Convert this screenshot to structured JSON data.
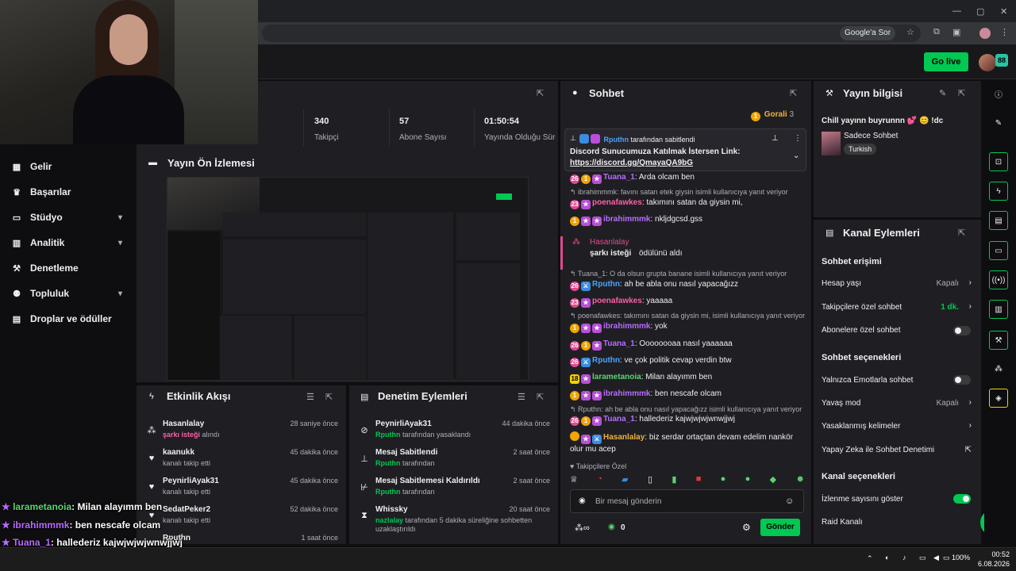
{
  "browser": {
    "google_sor": "Google'a Sor"
  },
  "header": {
    "go_live": "Go live",
    "avatar_badge": "88"
  },
  "nav": [
    {
      "label": "Gelir",
      "icon": "revenue-icon",
      "chevron": false
    },
    {
      "label": "Başarılar",
      "icon": "trophy-icon",
      "chevron": false
    },
    {
      "label": "Stüdyo",
      "icon": "studio-icon",
      "chevron": true
    },
    {
      "label": "Analitik",
      "icon": "analytics-icon",
      "chevron": true
    },
    {
      "label": "Denetleme",
      "icon": "wrench-icon",
      "chevron": false
    },
    {
      "label": "Topluluk",
      "icon": "community-icon",
      "chevron": true
    },
    {
      "label": "Droplar ve ödüller",
      "icon": "gift-icon",
      "chevron": false
    }
  ],
  "stats": [
    {
      "value": "340",
      "label": "Takipçi"
    },
    {
      "value": "57",
      "label": "Abone Sayısı"
    },
    {
      "value": "01:50:54",
      "label": "Yayında Olduğu Süre"
    }
  ],
  "preview": {
    "title": "Yayın Ön İzlemesi"
  },
  "activity": {
    "title": "Etkinlik Akışı",
    "items": [
      {
        "name": "Hasanlalay",
        "sub": "şarkı isteği",
        "sub2": "alındı",
        "time": "28 saniye önce",
        "icon": "channel-points-icon"
      },
      {
        "name": "kaanukk",
        "sub": "kanalı takip etti",
        "sub2": "",
        "time": "45 dakika önce",
        "icon": "heart-icon"
      },
      {
        "name": "PeynirliAyak31",
        "sub": "kanalı takip etti",
        "sub2": "",
        "time": "45 dakika önce",
        "icon": "heart-icon"
      },
      {
        "name": "SedatPeker2",
        "sub": "kanalı takip etti",
        "sub2": "",
        "time": "52 dakika önce",
        "icon": "heart-icon"
      },
      {
        "name": "Rputhn",
        "sub": "",
        "sub2": "",
        "time": "1 saat önce",
        "icon": "heart-icon"
      }
    ]
  },
  "moderation": {
    "title": "Denetim Eylemleri",
    "items": [
      {
        "name": "PeynirliAyak31",
        "actor": "Rputhn",
        "sub": "tarafından yasaklandı",
        "time": "44 dakika önce",
        "icon": "ban-icon"
      },
      {
        "name": "Mesaj Sabitlendi",
        "actor": "Rputhn",
        "sub": "tarafından",
        "time": "2 saat önce",
        "icon": "pin-icon"
      },
      {
        "name": "Mesaj Sabitlemesi Kaldırıldı",
        "actor": "Rputhn",
        "sub": "tarafından",
        "time": "2 saat önce",
        "icon": "unpin-icon"
      },
      {
        "name": "Whissky",
        "actor": "nazlalay",
        "sub": "tarafından 5 dakika süreliğine sohbetten uzaklaştırıldı",
        "time": "20 saat önce",
        "icon": "timeout-icon"
      }
    ]
  },
  "chat": {
    "title": "Sohbet",
    "gorali_label": "Gorali",
    "gorali_count": "3",
    "pinned_by": "Rputhn",
    "pinned_by_suffix": "tarafından sabitlendi",
    "pinned_text": "Discord Sunucumuza Katılmak İstersen Link:",
    "pinned_link": "https://discord.gg/QmayaQA9bG",
    "messages": [
      {
        "type": "msg",
        "badges": [
          "b-sub:26",
          "b-gold:1",
          "b-star"
        ],
        "user": "Tuana_1",
        "ucls": "u-purple",
        "text": ": Arda olcam ben"
      },
      {
        "type": "reply",
        "text": "ibrahimmmk: favını satan etek giysin isimli kullanıcıya yanıt veriyor"
      },
      {
        "type": "msg",
        "badges": [
          "b-sub:23",
          "b-star"
        ],
        "user": "poenafawkes",
        "ucls": "u-pink",
        "text": ": takımını satan da giysin mi,"
      },
      {
        "type": "msg",
        "badges": [
          "b-gold:1",
          "b-star",
          "b-star"
        ],
        "user": "ibrahimmmk",
        "ucls": "u-purple",
        "text": ": nkljdgcsd.gss"
      },
      {
        "type": "redeem",
        "user": "Hasanlalay",
        "text": "şarkı isteği",
        "suffix": "ödülünü aldı"
      },
      {
        "type": "reply",
        "text": "Tuana_1: O da olsun grupta banane isimli kullanıcıya yanıt veriyor"
      },
      {
        "type": "msg",
        "badges": [
          "b-sub:26",
          "b-blue"
        ],
        "user": "Rputhn",
        "ucls": "u-blue",
        "text": ": ah be abla onu nasıl yapacağızz"
      },
      {
        "type": "msg",
        "badges": [
          "b-sub:23",
          "b-star"
        ],
        "user": "poenafawkes",
        "ucls": "u-pink",
        "text": ": yaaaaa"
      },
      {
        "type": "reply",
        "text": "poenafawkes: takımını satan da giysin mi, isimli kullanıcıya yanıt veriyor"
      },
      {
        "type": "msg",
        "badges": [
          "b-gold:1",
          "b-star",
          "b-star"
        ],
        "user": "ibrahimmmk",
        "ucls": "u-purple",
        "text": ": yok"
      },
      {
        "type": "msg",
        "badges": [
          "b-sub:26",
          "b-gold:1",
          "b-star"
        ],
        "user": "Tuana_1",
        "ucls": "u-purple",
        "text": ": Oooooooaa nasıl yaaaaaa"
      },
      {
        "type": "msg",
        "badges": [
          "b-sub:26",
          "b-blue"
        ],
        "user": "Rputhn",
        "ucls": "u-blue",
        "text": ": ve çok politik cevap verdin btw"
      },
      {
        "type": "msg",
        "badges": [
          "b-yellow:18",
          "b-star"
        ],
        "user": "larametanoia",
        "ucls": "u-green",
        "text": ": Milan alayımm ben"
      },
      {
        "type": "msg",
        "badges": [
          "b-gold:1",
          "b-star",
          "b-star"
        ],
        "user": "ibrahimmmk",
        "ucls": "u-purple",
        "text": ": ben nescafe olcam"
      },
      {
        "type": "reply",
        "text": "Rputhn: ah be abla onu nasıl yapacağızz isimli kullanıcıya yanıt veriyor"
      },
      {
        "type": "msg",
        "badges": [
          "b-sub:26",
          "b-gold:1",
          "b-star"
        ],
        "user": "Tuana_1",
        "ucls": "u-purple",
        "text": ": hallederiz kajwjwjwjwnwjjwj"
      },
      {
        "type": "msg2",
        "badges": [
          "b-gold",
          "b-star",
          "b-blue"
        ],
        "user": "Hasanlalay",
        "ucls": "u-gold",
        "text": ": biz serdar ortaçtan devam edelim nankör",
        "text2": "olur mu acep"
      }
    ],
    "followers_only": "Takipçilere Özel",
    "placeholder": "Bir mesaj gönderin",
    "points": "0",
    "send": "Gönder"
  },
  "stream_info": {
    "title": "Yayın bilgisi",
    "stream_title": "Chill yayınn buyrunnn 💕 😊 !dc",
    "category": "Sadece Sohbet",
    "tag": "Turkish"
  },
  "channel_actions": {
    "title": "Kanal Eylemleri",
    "sections": {
      "chat_access": "Sohbet erişimi",
      "chat_options": "Sohbet seçenekleri",
      "channel_options": "Kanal seçenekleri"
    },
    "rows": {
      "account_age": "Hesap yaşı",
      "account_age_val": "Kapalı",
      "followers_only": "Takipçilere özel sohbet",
      "followers_only_val": "1 dk.",
      "subs_only": "Abonelere özel sohbet",
      "emote_only": "Yalnızca Emotlarla sohbet",
      "slow_mode": "Yavaş mod",
      "slow_mode_val": "Kapalı",
      "banned_words": "Yasaklanmış kelimeler",
      "ai_mod": "Yapay Zeka ile Sohbet Denetimi",
      "show_viewers": "İzlenme sayısını göster",
      "raid": "Raid Kanalı"
    }
  },
  "overlay_chat": [
    {
      "user": "larametanoia",
      "color": "#5bd670",
      "text": ": Milan alayımm ben"
    },
    {
      "user": "ibrahimmmk",
      "color": "#b86cff",
      "text": ": ben nescafe olcam"
    },
    {
      "user": "Tuana_1",
      "color": "#b86cff",
      "text": ": hallederiz kajwjwjwjwnwjjwj"
    },
    {
      "user": "Hasanlalay",
      "color": "#f0b13c",
      "text": ": biz serdar ortaçtan devam edelim nankör olur mu acep"
    }
  ],
  "taskbar": {
    "battery": "100%",
    "time": "00:52",
    "date": "6.08.2026"
  },
  "colors": {
    "accent": "#00c853",
    "panel": "#1f1f23",
    "bg": "#0e0e10"
  }
}
